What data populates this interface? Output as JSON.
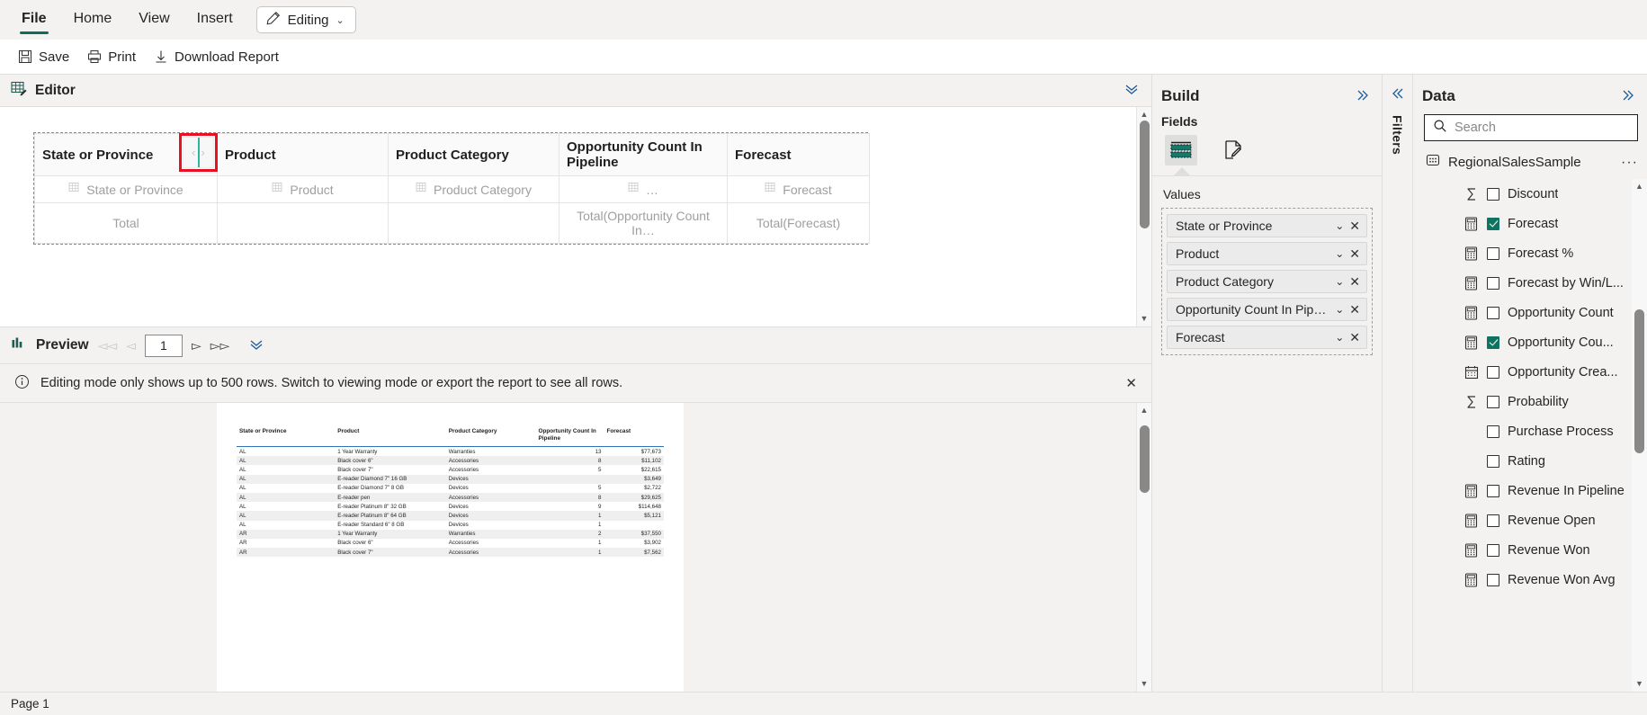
{
  "ribbon": {
    "tabs": [
      {
        "label": "File",
        "active": true
      },
      {
        "label": "Home",
        "active": false
      },
      {
        "label": "View",
        "active": false
      },
      {
        "label": "Insert",
        "active": false
      }
    ],
    "mode_chip": {
      "label": "Editing",
      "icon": "pencil-icon",
      "chevron": "⌄"
    }
  },
  "commands": [
    {
      "label": "Save",
      "icon": "save-icon"
    },
    {
      "label": "Print",
      "icon": "printer-icon"
    },
    {
      "label": "Download Report",
      "icon": "download-icon"
    }
  ],
  "editor": {
    "title": "Editor",
    "icon": "table-edit-icon",
    "collapse_icon": "chevron-double-down-icon",
    "tablix": {
      "columns": [
        {
          "header": "State or Province",
          "cell": "State or Province",
          "total": "Total"
        },
        {
          "header": "Product",
          "cell": "Product",
          "total": ""
        },
        {
          "header": "Product Category",
          "cell": "Product Category",
          "total": ""
        },
        {
          "header": "Opportunity Count In Pipeline",
          "cell": "…",
          "total": "Total(Opportunity Count In…"
        },
        {
          "header": "Forecast",
          "cell": "Forecast",
          "total": "Total(Forecast)"
        }
      ]
    },
    "resize_handle": {
      "left_arrow": "‹",
      "right_arrow": "›",
      "highlight_color": "#e81123",
      "bar_color": "#2bb6a3"
    },
    "scrollbar": {
      "up": "▲",
      "down": "▼"
    }
  },
  "preview": {
    "title": "Preview",
    "icon": "preview-bars-icon",
    "collapse_icon": "chevron-double-down-icon",
    "nav": {
      "first": "◅◅",
      "prev": "◅",
      "page_value": "1",
      "next": "▻",
      "last": "▻▻"
    },
    "notice": {
      "icon": "info-icon",
      "text": "Editing mode only shows up to 500 rows. Switch to viewing mode or export the report to see all rows.",
      "close": "✕"
    },
    "report_table": {
      "headers": [
        "State or Province",
        "Product",
        "Product Category",
        "Opportunity Count In Pipeline",
        "Forecast"
      ],
      "rows": [
        [
          "AL",
          "1 Year Warranty",
          "Warranties",
          "13",
          "$77,673"
        ],
        [
          "AL",
          "Black cover 6\"",
          "Accessories",
          "8",
          "$11,102"
        ],
        [
          "AL",
          "Black cover 7\"",
          "Accessories",
          "5",
          "$22,615"
        ],
        [
          "AL",
          "E-reader Diamond 7\" 16 GB",
          "Devices",
          "",
          "$3,649"
        ],
        [
          "AL",
          "E-reader Diamond 7\" 8 GB",
          "Devices",
          "5",
          "$2,722"
        ],
        [
          "AL",
          "E-reader pen",
          "Accessories",
          "8",
          "$29,625"
        ],
        [
          "AL",
          "E-reader Platinum 8\" 32 GB",
          "Devices",
          "9",
          "$114,648"
        ],
        [
          "AL",
          "E-reader Platinum 8\" 64 GB",
          "Devices",
          "1",
          "$5,121"
        ],
        [
          "AL",
          "E-reader Standard 6\" 8 GB",
          "Devices",
          "1",
          ""
        ],
        [
          "AR",
          "1 Year Warranty",
          "Warranties",
          "2",
          "$37,550"
        ],
        [
          "AR",
          "Black cover 6\"",
          "Accessories",
          "1",
          "$3,902"
        ],
        [
          "AR",
          "Black cover 7\"",
          "Accessories",
          "1",
          "$7,562"
        ]
      ]
    },
    "scrollbar": {
      "up": "▲",
      "down": "▼"
    }
  },
  "build": {
    "title": "Build",
    "expand_icon": "chevron-double-right-icon",
    "fields_label": "Fields",
    "tabs": [
      {
        "name": "fields-tab-icon",
        "selected": true
      },
      {
        "name": "format-tab-icon",
        "selected": false
      }
    ],
    "values_label": "Values",
    "values": [
      {
        "label": "State or Province",
        "chevron": "⌄",
        "remove": "✕"
      },
      {
        "label": "Product",
        "chevron": "⌄",
        "remove": "✕"
      },
      {
        "label": "Product Category",
        "chevron": "⌄",
        "remove": "✕"
      },
      {
        "label": "Opportunity Count In Pipeline",
        "chevron": "⌄",
        "remove": "✕"
      },
      {
        "label": "Forecast",
        "chevron": "⌄",
        "remove": "✕"
      }
    ]
  },
  "filters": {
    "label": "Filters",
    "collapse_icon": "chevron-double-left-icon"
  },
  "data": {
    "title": "Data",
    "expand_icon": "chevron-double-right-icon",
    "search": {
      "placeholder": "Search",
      "value": "",
      "icon": "search-icon"
    },
    "dataset": {
      "name": "RegionalSalesSample",
      "icon": "dataset-icon",
      "menu": "···"
    },
    "fields": [
      {
        "label": "Discount",
        "icon": "sigma-icon",
        "checked": false
      },
      {
        "label": "Forecast",
        "icon": "measure-icon",
        "checked": true
      },
      {
        "label": "Forecast %",
        "icon": "measure-icon",
        "checked": false
      },
      {
        "label": "Forecast by Win/L...",
        "icon": "measure-icon",
        "checked": false
      },
      {
        "label": "Opportunity Count",
        "icon": "measure-icon",
        "checked": false
      },
      {
        "label": "Opportunity Cou...",
        "icon": "measure-icon",
        "checked": true
      },
      {
        "label": "Opportunity Crea...",
        "icon": "calendar-icon",
        "checked": false
      },
      {
        "label": "Probability",
        "icon": "sigma-icon",
        "checked": false
      },
      {
        "label": "Purchase Process",
        "icon": "none",
        "checked": false
      },
      {
        "label": "Rating",
        "icon": "none",
        "checked": false
      },
      {
        "label": "Revenue In Pipeline",
        "icon": "measure-icon",
        "checked": false
      },
      {
        "label": "Revenue Open",
        "icon": "measure-icon",
        "checked": false
      },
      {
        "label": "Revenue Won",
        "icon": "measure-icon",
        "checked": false
      },
      {
        "label": "Revenue Won Avg",
        "icon": "measure-icon",
        "checked": false
      }
    ],
    "scrollbar": {
      "up": "▲",
      "down": "▼"
    }
  },
  "status": {
    "page_label": "Page 1"
  }
}
